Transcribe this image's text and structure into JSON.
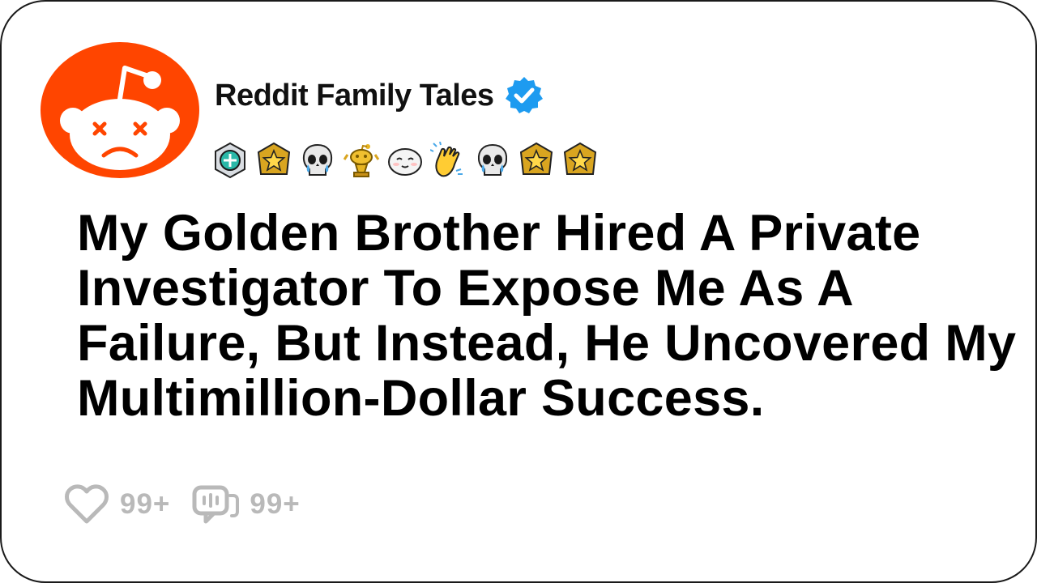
{
  "channel": {
    "name": "Reddit Family Tales",
    "verified": true,
    "avatar_icon": "reddit-snoo-dead-icon",
    "brand_color": "#ff4500",
    "verified_color": "#1d9bf0"
  },
  "badges": [
    {
      "icon": "helper-badge-icon"
    },
    {
      "icon": "gold-star-badge-icon"
    },
    {
      "icon": "crying-skull-icon"
    },
    {
      "icon": "gold-snoo-trophy-icon"
    },
    {
      "icon": "blushing-face-icon"
    },
    {
      "icon": "clapping-hands-icon"
    },
    {
      "icon": "crying-skull-icon"
    },
    {
      "icon": "gold-star-badge-icon"
    },
    {
      "icon": "gold-star-badge-icon"
    }
  ],
  "post": {
    "title": "My Golden Brother Hired A Private Investigator To Expose Me As A Failure, But Instead, He Uncovered My Multimillion-Dollar Success."
  },
  "stats": {
    "likes": "99+",
    "comments": "99+",
    "icon_color": "#b9b9b9"
  }
}
